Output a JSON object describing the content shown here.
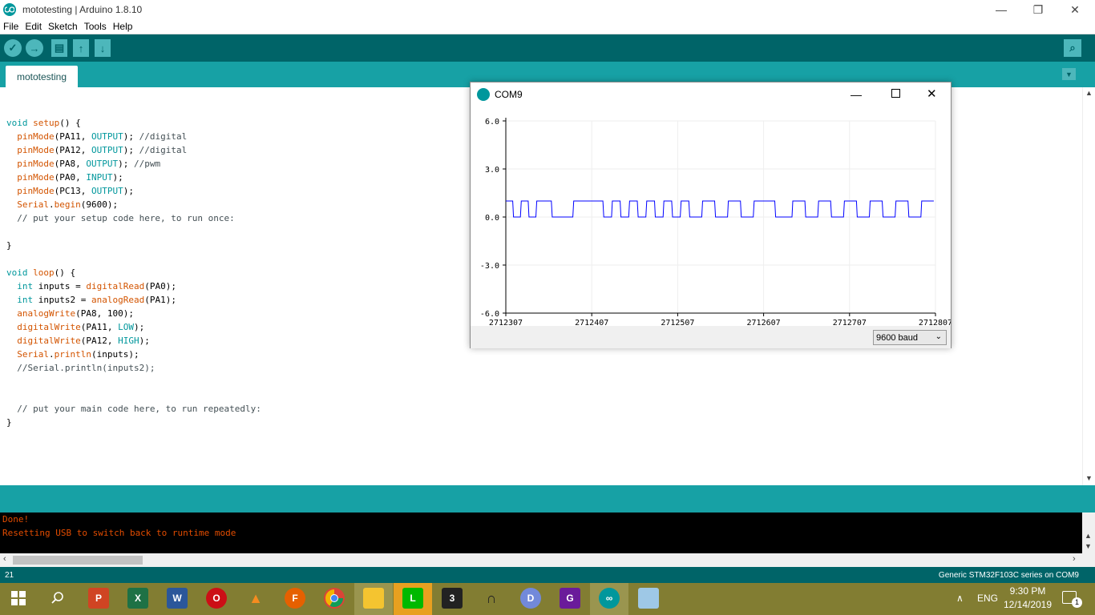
{
  "window": {
    "title": "mototesting | Arduino 1.8.10"
  },
  "menu": [
    "File",
    "Edit",
    "Sketch",
    "Tools",
    "Help"
  ],
  "tab": {
    "label": "mototesting"
  },
  "code": [
    "",
    "void setup() {",
    "  pinMode(PA11, OUTPUT); //digital",
    "  pinMode(PA12, OUTPUT); //digital",
    "  pinMode(PA8, OUTPUT); //pwm",
    "  pinMode(PA0, INPUT);",
    "  pinMode(PC13, OUTPUT);",
    "  Serial.begin(9600);",
    "  // put your setup code here, to run once:",
    "",
    "}",
    "",
    "void loop() {",
    "  int inputs = digitalRead(PA0);",
    "  int inputs2 = analogRead(PA1);",
    "  analogWrite(PA8, 100);",
    "  digitalWrite(PA11, LOW);",
    "  digitalWrite(PA12, HIGH);",
    "  Serial.println(inputs);",
    "  //Serial.println(inputs2);",
    "",
    "",
    "  // put your main code here, to run repeatedly:",
    "}"
  ],
  "console": [
    "Done!",
    "Resetting USB to switch back to runtime mode"
  ],
  "status": {
    "line": "21",
    "board": "Generic STM32F103C series on COM9"
  },
  "plotter": {
    "title": "COM9",
    "baud": "9600 baud",
    "yticks": [
      "6.0",
      "3.0",
      "0.0",
      "-3.0",
      "-6.0"
    ],
    "xticks": [
      "2712307",
      "2712407",
      "2712507",
      "2712607",
      "2712707",
      "2712807"
    ]
  },
  "chart_data": {
    "type": "line",
    "title": "",
    "xlabel": "",
    "ylabel": "",
    "ylim": [
      -6,
      6
    ],
    "xlim": [
      2712307,
      2712807
    ],
    "grid": true,
    "series_color": "#0000ff",
    "series": [
      {
        "name": "",
        "values_description_free": true,
        "x": [
          2712307,
          2712315,
          2712316,
          2712324,
          2712325,
          2712333,
          2712334,
          2712342,
          2712343,
          2712360,
          2712361,
          2712385,
          2712386,
          2712420,
          2712421,
          2712430,
          2712431,
          2712440,
          2712441,
          2712450,
          2712451,
          2712460,
          2712461,
          2712470,
          2712471,
          2712480,
          2712481,
          2712490,
          2712491,
          2712500,
          2712501,
          2712510,
          2712511,
          2712520,
          2712521,
          2712535,
          2712536,
          2712550,
          2712551,
          2712565,
          2712566,
          2712580,
          2712581,
          2712595,
          2712596,
          2712620,
          2712621,
          2712640,
          2712641,
          2712655,
          2712656,
          2712670,
          2712671,
          2712685,
          2712686,
          2712700,
          2712701,
          2712715,
          2712716,
          2712730,
          2712731,
          2712745,
          2712746,
          2712760,
          2712761,
          2712775,
          2712776,
          2712790,
          2712791,
          2712805
        ],
        "y": [
          1,
          1,
          0,
          0,
          1,
          1,
          0,
          0,
          1,
          1,
          0,
          0,
          1,
          1,
          0,
          0,
          1,
          1,
          0,
          0,
          1,
          1,
          0,
          0,
          1,
          1,
          0,
          0,
          1,
          1,
          0,
          0,
          1,
          1,
          0,
          0,
          1,
          1,
          0,
          0,
          1,
          1,
          0,
          0,
          1,
          1,
          0,
          0,
          1,
          1,
          0,
          0,
          1,
          1,
          0,
          0,
          1,
          1,
          0,
          0,
          1,
          1,
          0,
          0,
          1,
          1,
          0,
          0,
          1,
          1
        ]
      }
    ]
  },
  "taskbar": {
    "lang": "ENG",
    "time": "9:30 PM",
    "date": "12/14/2019",
    "notif": "1"
  },
  "colors": {
    "teal_dark": "#006468",
    "teal": "#17a1a5",
    "console_text": "#e34c00"
  }
}
